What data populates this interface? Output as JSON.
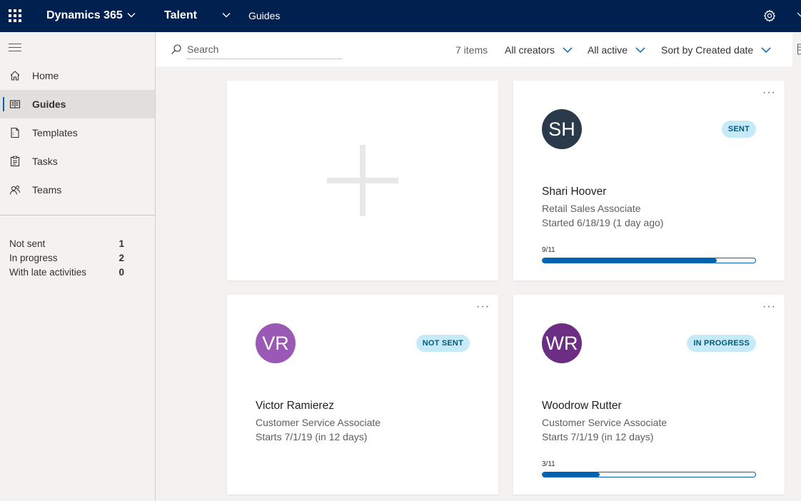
{
  "topbar": {
    "brand": "Dynamics 365",
    "app": "Talent",
    "breadcrumb": "Guides",
    "bg_color": "#002050"
  },
  "sidebar": {
    "items": [
      {
        "label": "Home",
        "icon": "home-icon"
      },
      {
        "label": "Guides",
        "icon": "guides-icon",
        "active": true
      },
      {
        "label": "Templates",
        "icon": "templates-icon"
      },
      {
        "label": "Tasks",
        "icon": "tasks-icon"
      },
      {
        "label": "Teams",
        "icon": "teams-icon"
      }
    ],
    "stats": [
      {
        "label": "Not sent",
        "value": "1"
      },
      {
        "label": "In progress",
        "value": "2"
      },
      {
        "label": "With late activities",
        "value": "0"
      }
    ]
  },
  "commandbar": {
    "search_placeholder": "Search",
    "items_count": "7 items",
    "creators_filter": "All creators",
    "active_filter": "All active",
    "sort": "Sort by Created date"
  },
  "cards": [
    {
      "initials": "SH",
      "avatar_color": "#2b3a4a",
      "status": "SENT",
      "name": "Shari Hoover",
      "role": "Retail Sales Associate",
      "start": "Started 6/18/19 (1 day ago)",
      "progress_label": "9/11",
      "progress": 0.82
    },
    {
      "initials": "VR",
      "avatar_color": "#9b59b6",
      "status": "NOT SENT",
      "name": "Victor Ramierez",
      "role": "Customer Service Associate",
      "start": "Starts 7/1/19 (in 12 days)"
    },
    {
      "initials": "WR",
      "avatar_color": "#6b2e83",
      "status": "IN PROGRESS",
      "name": "Woodrow Rutter",
      "role": "Customer Service Associate",
      "start": "Starts 7/1/19 (in 12 days)",
      "progress_label": "3/11",
      "progress": 0.27
    }
  ],
  "accent_color": "#0063b1"
}
